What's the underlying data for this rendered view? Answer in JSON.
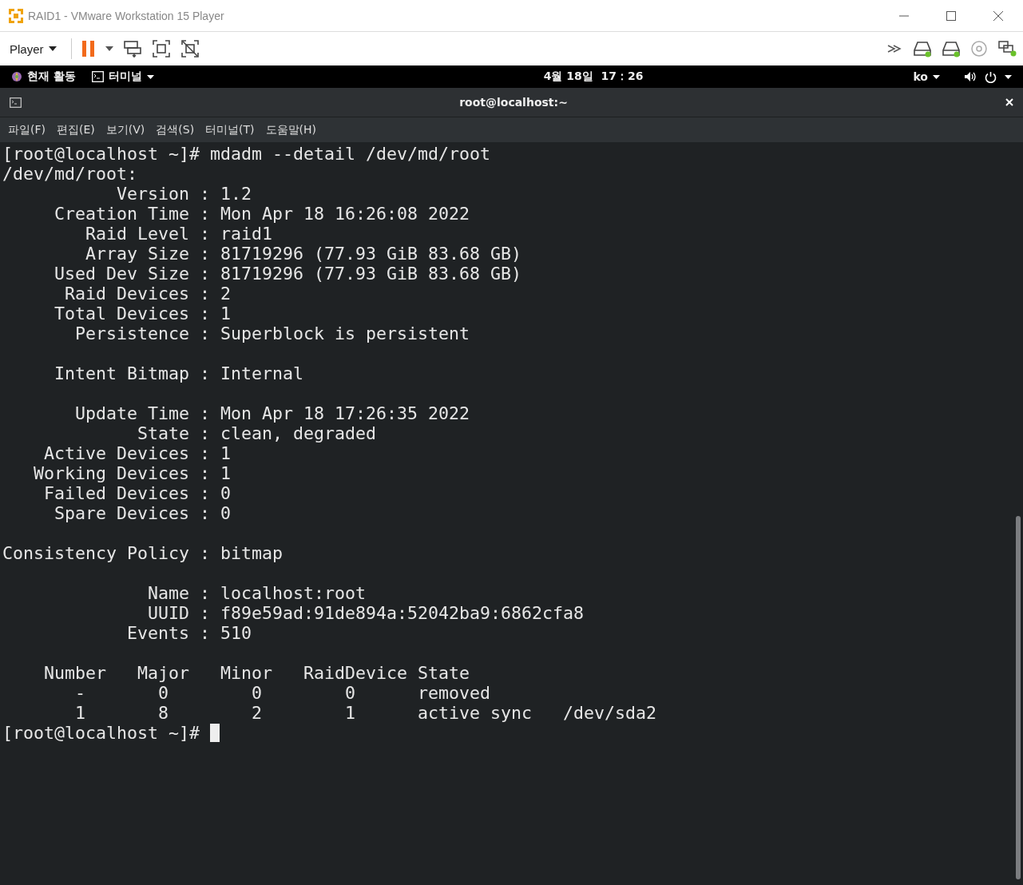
{
  "window": {
    "title": "RAID1 - VMware Workstation 15 Player"
  },
  "toolbar": {
    "menu": "Player"
  },
  "topbar": {
    "activities": "현재 활동",
    "app_menu": "터미널",
    "clock": "4월 18일  17：26",
    "input_method": "ko"
  },
  "terminal": {
    "title": "root@localhost:~",
    "menus": [
      "파일(F)",
      "편집(E)",
      "보기(V)",
      "검색(S)",
      "터미널(T)",
      "도움말(H)"
    ],
    "blocks": [
      [
        "[root@localhost ~]# mdadm --detail /dev/md/root",
        "/dev/md/root:",
        "           Version : 1.2",
        "     Creation Time : Mon Apr 18 16:26:08 2022",
        "        Raid Level : raid1",
        "        Array Size : 81719296 (77.93 GiB 83.68 GB)",
        "     Used Dev Size : 81719296 (77.93 GiB 83.68 GB)",
        "      Raid Devices : 2",
        "     Total Devices : 1",
        "       Persistence : Superblock is persistent"
      ],
      [
        "     Intent Bitmap : Internal"
      ],
      [
        "       Update Time : Mon Apr 18 17:26:35 2022",
        "             State : clean, degraded",
        "    Active Devices : 1",
        "   Working Devices : 1",
        "    Failed Devices : 0",
        "     Spare Devices : 0"
      ],
      [
        "Consistency Policy : bitmap"
      ],
      [
        "              Name : localhost:root",
        "              UUID : f89e59ad:91de894a:52042ba9:6862cfa8",
        "            Events : 510"
      ],
      [
        "    Number   Major   Minor   RaidDevice State",
        "       -       0        0        0      removed",
        "       1       8        2        1      active sync   /dev/sda2"
      ]
    ],
    "prompt": "[root@localhost ~]# "
  }
}
